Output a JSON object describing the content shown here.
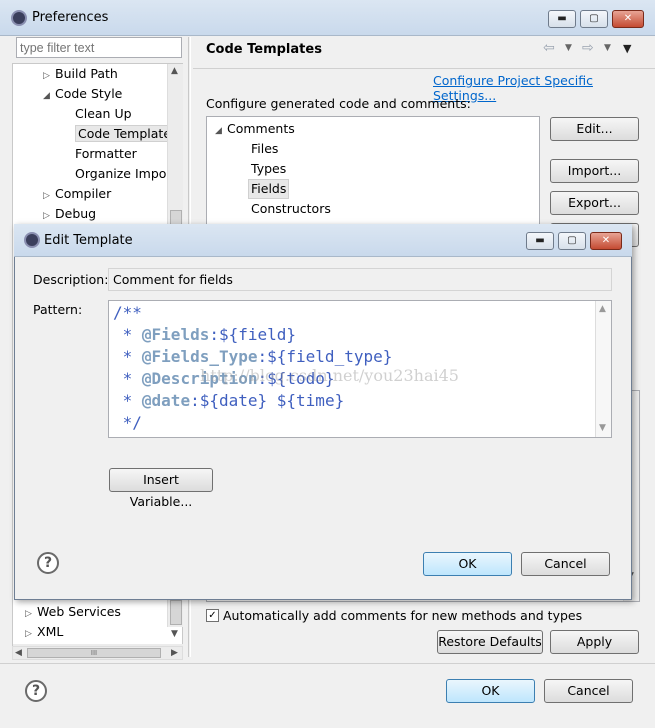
{
  "window": {
    "title": "Preferences"
  },
  "filter": {
    "placeholder": "type filter text"
  },
  "tree": {
    "items": [
      {
        "label": "Build Path",
        "indent": 1,
        "expander": "▷"
      },
      {
        "label": "Code Style",
        "indent": 1,
        "expander": "◢"
      },
      {
        "label": "Clean Up",
        "indent": 2,
        "expander": ""
      },
      {
        "label": "Code Template",
        "indent": 2,
        "expander": "",
        "selected": true
      },
      {
        "label": "Formatter",
        "indent": 2,
        "expander": ""
      },
      {
        "label": "Organize Impo",
        "indent": 2,
        "expander": ""
      },
      {
        "label": "Compiler",
        "indent": 1,
        "expander": "▷"
      },
      {
        "label": "Debug",
        "indent": 1,
        "expander": "▷"
      }
    ],
    "bottom_items": [
      {
        "label": "Web Services",
        "expander": "▷"
      },
      {
        "label": "XML",
        "expander": "▷"
      }
    ]
  },
  "page": {
    "title": "Code Templates",
    "configure_link": "Configure Project Specific Settings...",
    "configure_label": "Configure generated code and comments:",
    "comments_node": "Comments",
    "comment_items": [
      "Files",
      "Types",
      "Fields",
      "Constructors"
    ],
    "edit_button": "Edit...",
    "import_button": "Import...",
    "export_button": "Export...",
    "auto_add_label": "Automatically add comments for new methods and types",
    "restore_button": "Restore Defaults",
    "apply_button": "Apply"
  },
  "footer": {
    "ok": "OK",
    "cancel": "Cancel"
  },
  "dialog": {
    "title": "Edit Template",
    "description_label": "Description:",
    "description_value": "Comment for fields",
    "pattern_label": "Pattern:",
    "pattern_lines": [
      "/**",
      " * @Fields:${field}",
      " * @Fields_Type:${field_type}",
      " * @Description:${todo}",
      " * @date:${date} ${time}",
      " */"
    ],
    "insert_variable": "Insert Variable...",
    "ok": "OK",
    "cancel": "Cancel"
  },
  "watermark": "http://blog.csdn.net/you23hai45",
  "hscroll_thumb": "III"
}
